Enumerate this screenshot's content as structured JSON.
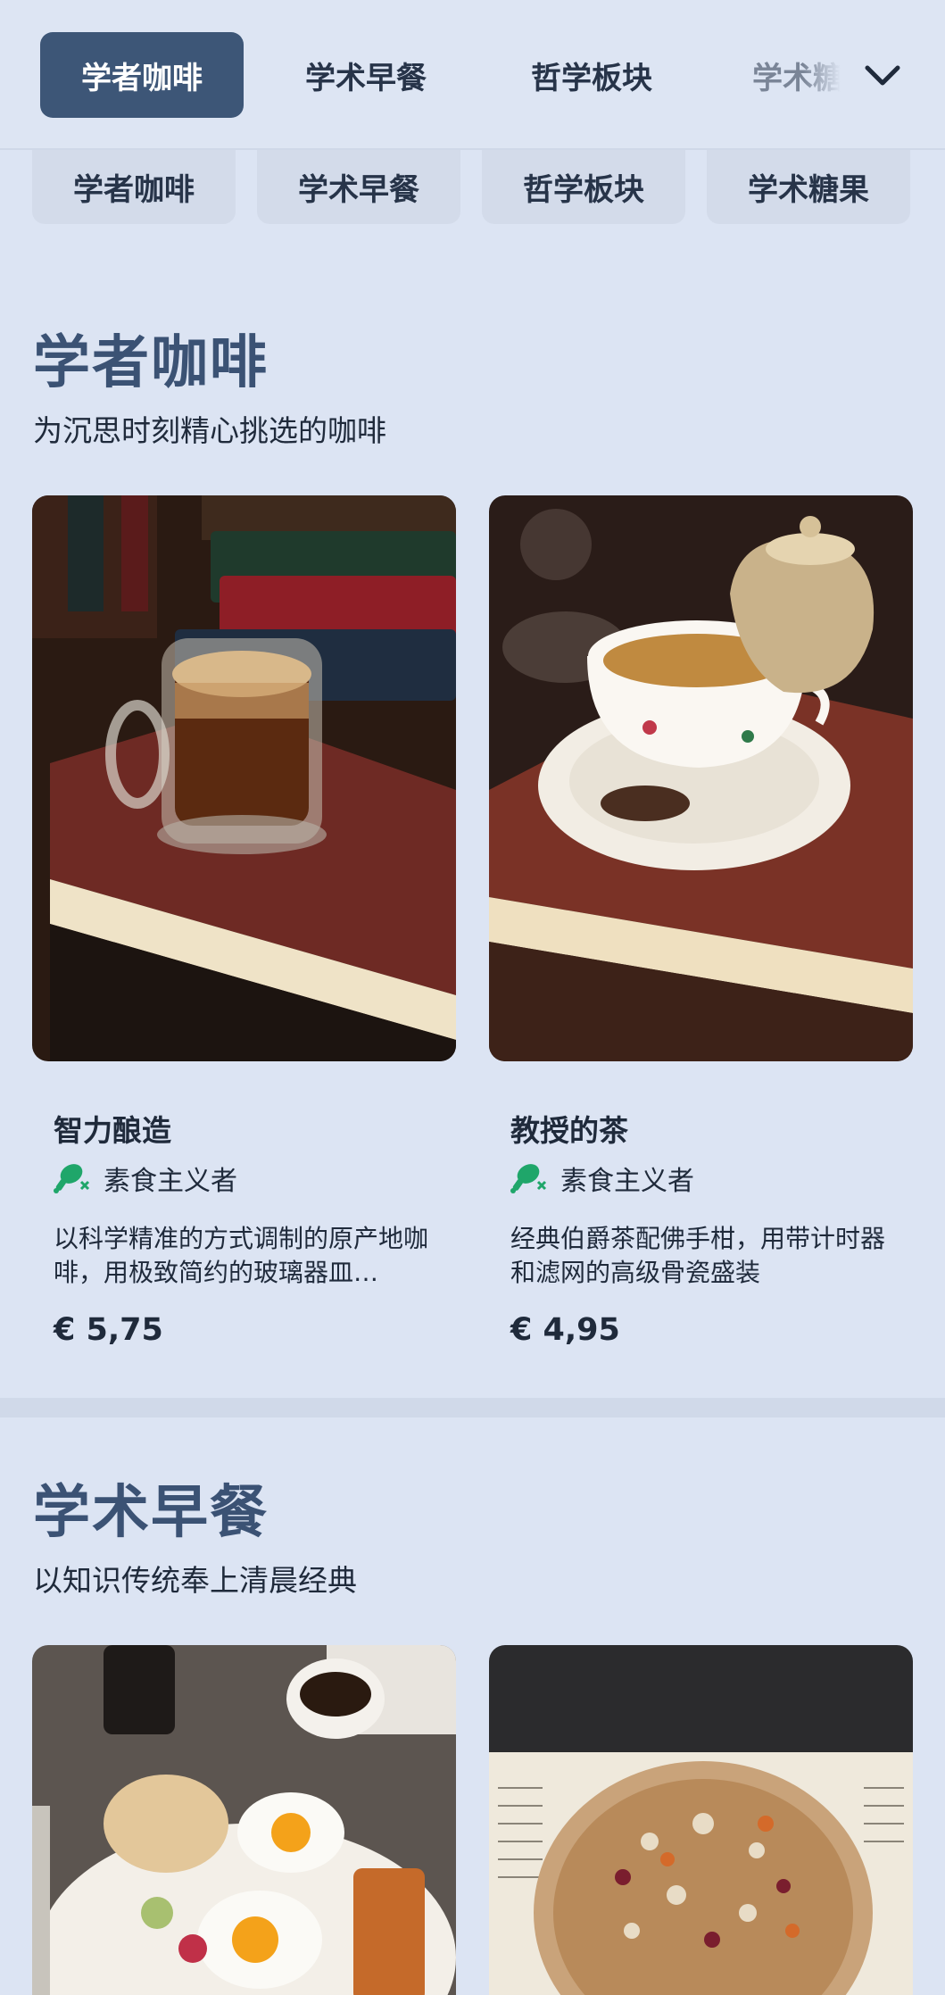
{
  "top_tabs": [
    {
      "label": "学者咖啡",
      "active": true
    },
    {
      "label": "学术早餐"
    },
    {
      "label": "哲学板块"
    },
    {
      "label": "学术糖"
    }
  ],
  "chips": [
    "学者咖啡",
    "学术早餐",
    "哲学板块",
    "学术糖果"
  ],
  "sections": [
    {
      "title": "学者咖啡",
      "subtitle": "为沉思时刻精心挑选的咖啡",
      "items": [
        {
          "name": "智力酿造",
          "tag": "素食主义者",
          "desc": "以科学精准的方式调制的原产地咖啡，用极致简约的玻璃器皿…",
          "price": "€ 5,75"
        },
        {
          "name": "教授的茶",
          "tag": "素食主义者",
          "desc": "经典伯爵茶配佛手柑，用带计时器和滤网的高级骨瓷盛装",
          "price": "€ 4,95"
        }
      ]
    },
    {
      "title": "学术早餐",
      "subtitle": "以知识传统奉上清晨经典"
    }
  ],
  "icons": {
    "chevron": "chevron-down-icon",
    "veg": "vegetarian-drumstick-icon"
  },
  "colors": {
    "accent": "#3d5677",
    "background": "#dce4f3",
    "veg_green": "#1fa66a"
  }
}
